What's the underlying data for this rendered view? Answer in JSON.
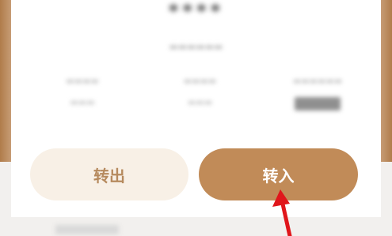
{
  "actions": {
    "transfer_out_label": "转出",
    "transfer_in_label": "转入"
  },
  "summary": {
    "balance_masked": "****"
  },
  "colors": {
    "primary": "#c18b58",
    "secondary_bg": "#f8f0e6",
    "secondary_text": "#b68a5e",
    "annotation_arrow": "#e0161b"
  }
}
